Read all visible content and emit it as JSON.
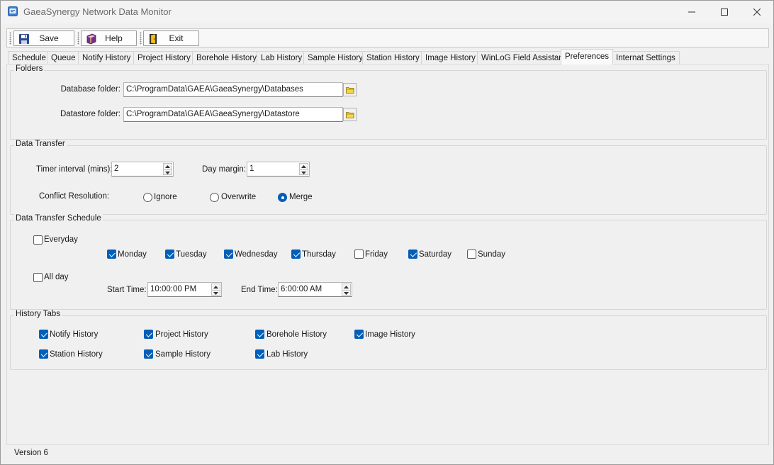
{
  "window": {
    "title": "GaeaSynergy Network Data Monitor"
  },
  "toolbar": {
    "save_label": "Save",
    "help_label": "Help",
    "exit_label": "Exit"
  },
  "tabs": [
    {
      "label": "Schedule"
    },
    {
      "label": "Queue"
    },
    {
      "label": "Notify History"
    },
    {
      "label": "Project History"
    },
    {
      "label": "Borehole History"
    },
    {
      "label": "Lab History"
    },
    {
      "label": "Sample History"
    },
    {
      "label": "Station History"
    },
    {
      "label": "Image History"
    },
    {
      "label": "WinLoG Field Assistant"
    },
    {
      "label": "Preferences",
      "active": true
    },
    {
      "label": "Internat Settings"
    }
  ],
  "folders": {
    "title": "Folders",
    "database_label": "Database folder:",
    "database_value": "C:\\ProgramData\\GAEA\\GaeaSynergy\\Databases",
    "datastore_label": "Datastore folder:",
    "datastore_value": "C:\\ProgramData\\GAEA\\GaeaSynergy\\Datastore"
  },
  "data_transfer": {
    "title": "Data Transfer",
    "timer_label": "Timer interval (mins):",
    "timer_value": "2",
    "day_margin_label": "Day margin:",
    "day_margin_value": "1",
    "conflict_label": "Conflict Resolution:",
    "options": {
      "ignore": "Ignore",
      "overwrite": "Overwrite",
      "merge": "Merge"
    },
    "selected": "Merge"
  },
  "schedule": {
    "title": "Data Transfer Schedule",
    "everyday_label": "Everyday",
    "everyday_checked": false,
    "days": {
      "monday": {
        "label": "Monday",
        "checked": true
      },
      "tuesday": {
        "label": "Tuesday",
        "checked": true
      },
      "wednesday": {
        "label": "Wednesday",
        "checked": true
      },
      "thursday": {
        "label": "Thursday",
        "checked": true
      },
      "friday": {
        "label": "Friday",
        "checked": false
      },
      "saturday": {
        "label": "Saturday",
        "checked": true
      },
      "sunday": {
        "label": "Sunday",
        "checked": false
      }
    },
    "allday_label": "All day",
    "allday_checked": false,
    "start_label": "Start Time:",
    "start_value": "10:00:00 PM",
    "end_label": "End Time:",
    "end_value": "6:00:00 AM"
  },
  "history_tabs": {
    "title": "History Tabs",
    "items": {
      "notify": {
        "label": "Notify History",
        "checked": true
      },
      "project": {
        "label": "Project History",
        "checked": true
      },
      "borehole": {
        "label": "Borehole History",
        "checked": true
      },
      "image": {
        "label": "Image History",
        "checked": true
      },
      "station": {
        "label": "Station History",
        "checked": true
      },
      "sample": {
        "label": "Sample History",
        "checked": true
      },
      "lab": {
        "label": "Lab History",
        "checked": true
      }
    }
  },
  "status": {
    "version": "Version 6"
  },
  "colors": {
    "accent": "#005fb8",
    "background": "#f0f0f0"
  }
}
